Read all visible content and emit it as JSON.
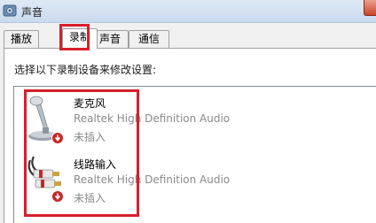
{
  "window": {
    "title": "声音",
    "title_icon": "speaker-icon",
    "close_icon": "close-icon"
  },
  "tabs": [
    {
      "label": "播放",
      "active": false
    },
    {
      "label": "录制",
      "active": true
    },
    {
      "label": "声音",
      "active": false
    },
    {
      "label": "通信",
      "active": false
    }
  ],
  "panel": {
    "instruction": "选择以下录制设备来修改设置:"
  },
  "devices": [
    {
      "name": "麦克风",
      "driver": "Realtek High Definition Audio",
      "status": "未插入",
      "icon": "microphone-icon",
      "status_icon": "unplugged-badge-icon"
    },
    {
      "name": "线路输入",
      "driver": "Realtek High Definition Audio",
      "status": "未插入",
      "icon": "line-in-cable-icon",
      "status_icon": "unplugged-badge-icon"
    }
  ],
  "colors": {
    "highlight_border": "#d6202b",
    "status_badge": "#c62828",
    "secondary_text": "#8a8a8a"
  }
}
